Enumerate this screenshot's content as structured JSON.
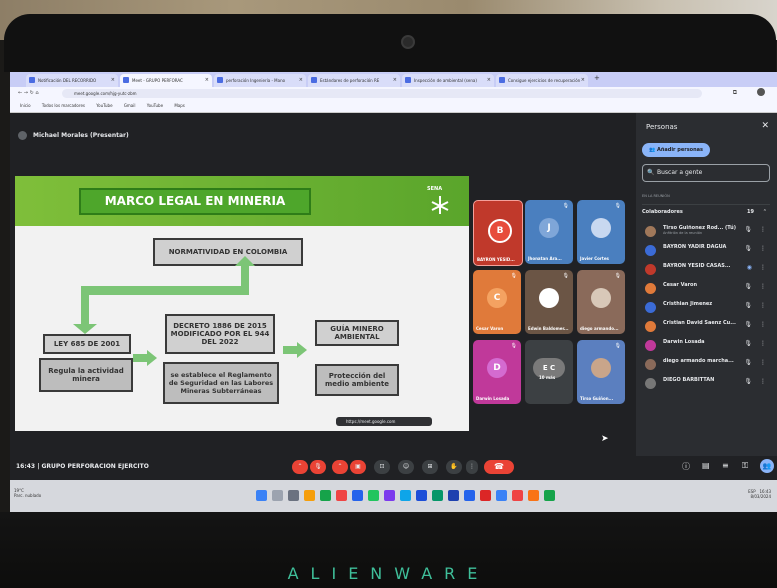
{
  "browser": {
    "tabs": [
      {
        "label": "Notificación DEL RECORRIDO"
      },
      {
        "label": "Meet - GRUPO PERFORAC"
      },
      {
        "label": "perforación Ingeniería - Mano"
      },
      {
        "label": "Estándares de perforación RE"
      },
      {
        "label": "Inspección de ambiental (sena)"
      },
      {
        "label": "Consigue ejercicios de recuperación"
      }
    ],
    "url": "meet.google.com/hjg-yutc-zbm",
    "bookmarks": [
      "Inicio",
      "Todos los marcadores",
      "YouTube",
      "Gmail",
      "YouTube",
      "Maps"
    ]
  },
  "meet": {
    "presenter": "Michael Morales (Presentar)",
    "meeting_time": "16:43",
    "meeting_name": "GRUPO PERFORACION EJERCITO",
    "url_chip": "https://meet.google.com"
  },
  "slide": {
    "title": "MARCO LEGAL EN MINERIA",
    "logo_text": "SENA",
    "boxes": {
      "normatividad": "NORMATIVIDAD EN COLOMBIA",
      "ley": "LEY 685 DE 2001",
      "regula": "Regula la actividad minera",
      "decreto": "DECRETO 1886 DE 2015 MODIFICADO POR EL 944 DEL 2022",
      "reglamento": "se establece el Reglamento de Seguridad en las Labores Mineras Subterráneas",
      "guia": "GUÍA MINERO AMBIENTAL",
      "proteccion": "Protección del medio ambiente"
    }
  },
  "tiles": [
    {
      "name": "BAYRON YESID...",
      "initial": "B",
      "color": "#c0392b",
      "bg": "#c0392b"
    },
    {
      "name": "Jhonatan Ara...",
      "initial": "J",
      "color": "#7fa6d8",
      "bg": "#4a7fbf"
    },
    {
      "name": "Javier Cortes",
      "initial": "",
      "color": "#6b8fbd",
      "bg": "#4a7fbf"
    },
    {
      "name": "Cesar Varon",
      "initial": "C",
      "color": "#f4a261",
      "bg": "#e07a3a"
    },
    {
      "name": "Edwin Baldomer...",
      "initial": "",
      "color": "#555",
      "bg": "#6b5545"
    },
    {
      "name": "diego armando...",
      "initial": "",
      "color": "#777",
      "bg": "#8a6a5a"
    },
    {
      "name": "Darwin Losada",
      "initial": "D",
      "color": "#d46bd0",
      "bg": "#c0399a"
    },
    {
      "name": "10 más",
      "initial": "E C",
      "color": "#7a7a7a",
      "bg": "#3c4043"
    },
    {
      "name": "Tirso Guiñon...",
      "initial": "",
      "color": "#6b8fbd",
      "bg": "#5b7fbf"
    }
  ],
  "people_panel": {
    "title": "Personas",
    "add_label": "Añadir personas",
    "search_placeholder": "Buscar a gente",
    "section_label": "EN LA REUNIÓN",
    "group_label": "Colaboradores",
    "group_count": "19",
    "rows": [
      {
        "name": "Tirso Guiñonez Rod... (Tú)",
        "sub": "Anfitrión de la reunión",
        "color": "#a0785a"
      },
      {
        "name": "BAYRON YADIR DAGUA",
        "sub": "",
        "color": "#3b6bd6"
      },
      {
        "name": "BAYRON YESID CASAS...",
        "sub": "",
        "color": "#c0392b"
      },
      {
        "name": "Cesar Varon",
        "sub": "",
        "color": "#e07a3a"
      },
      {
        "name": "Cristhian Jimenez",
        "sub": "",
        "color": "#3b6bd6"
      },
      {
        "name": "Cristian David Saenz Cu...",
        "sub": "",
        "color": "#e07a3a"
      },
      {
        "name": "Darwin Losada",
        "sub": "",
        "color": "#c0399a"
      },
      {
        "name": "diego armando marcha...",
        "sub": "",
        "color": "#8a6a5a"
      },
      {
        "name": "DIEGO BARBITTAN",
        "sub": "",
        "color": "#777"
      }
    ]
  },
  "taskbar": {
    "weather_temp": "19°C",
    "weather_text": "Parc. nublado",
    "time": "16:43",
    "date": "8/03/2024",
    "lang": "ESP"
  },
  "brand": "ALIENWARE"
}
